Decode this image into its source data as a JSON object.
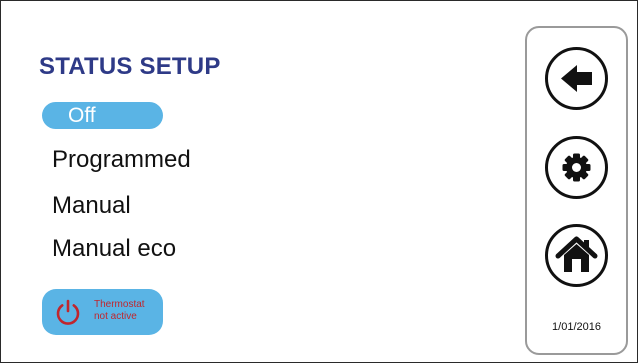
{
  "screen": {
    "title": "STATUS SETUP"
  },
  "options": {
    "off": "Off",
    "programmed": "Programmed",
    "manual": "Manual",
    "manual_eco": "Manual eco"
  },
  "thermostat_status": {
    "line1": "Thermostat",
    "line2": "not active",
    "icon": "power-icon"
  },
  "side_panel": {
    "back_icon": "arrow-left-icon",
    "settings_icon": "gear-icon",
    "home_icon": "home-icon",
    "date": "1/01/2016"
  },
  "colors": {
    "title": "#2e3a87",
    "selected_bg": "#5ab4e5",
    "status_text": "#c0262d",
    "panel_border": "#9a9a9a"
  }
}
